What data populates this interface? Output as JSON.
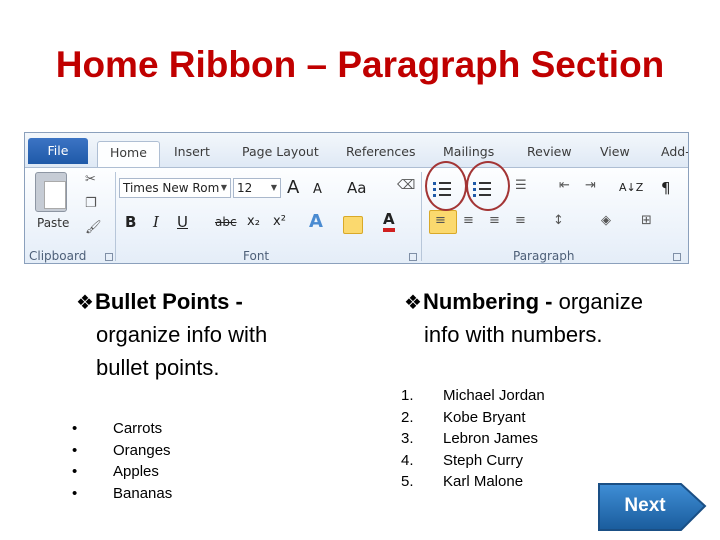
{
  "slide": {
    "title": "Home Ribbon – Paragraph Section"
  },
  "ribbon": {
    "tabs": [
      "File",
      "Home",
      "Insert",
      "Page Layout",
      "References",
      "Mailings",
      "Review",
      "View",
      "Add-"
    ],
    "groups": {
      "clipboard": "Clipboard",
      "font": "Font",
      "paragraph": "Paragraph"
    },
    "paste_label": "Paste",
    "font_name": "Times New Rom",
    "font_size": "12",
    "font_size_grow": "A",
    "font_case": "Aa",
    "bold": "B",
    "italic": "I",
    "underline": "U",
    "strike": "abc",
    "subscript": "x₂",
    "superscript": "x²",
    "pilcrow": "¶",
    "sort_glyph": "A↓Z"
  },
  "bullets_column": {
    "marker": "❖",
    "heading_bold": "Bullet Points - ",
    "heading_rest": "organize info with bullet points.",
    "heading_line2": "organize info with",
    "heading_line3": "bullet points.",
    "items": [
      "Carrots",
      "Oranges",
      "Apples",
      "Bananas"
    ]
  },
  "numbering_column": {
    "marker": "❖",
    "heading_bold": "Numbering - ",
    "heading_rest": "organize",
    "heading_line2": "info with numbers.",
    "items": [
      {
        "num": "1.",
        "text": "Michael Jordan"
      },
      {
        "num": "2.",
        "text": "Kobe Bryant"
      },
      {
        "num": "3.",
        "text": "Lebron James"
      },
      {
        "num": "4.",
        "text": "Steph Curry"
      },
      {
        "num": "5.",
        "text": "Karl Malone"
      }
    ]
  },
  "next_button": {
    "label": "Next"
  },
  "colors": {
    "title": "#c00000",
    "next_button": "#1f6fb5",
    "circle": "#a33535"
  }
}
